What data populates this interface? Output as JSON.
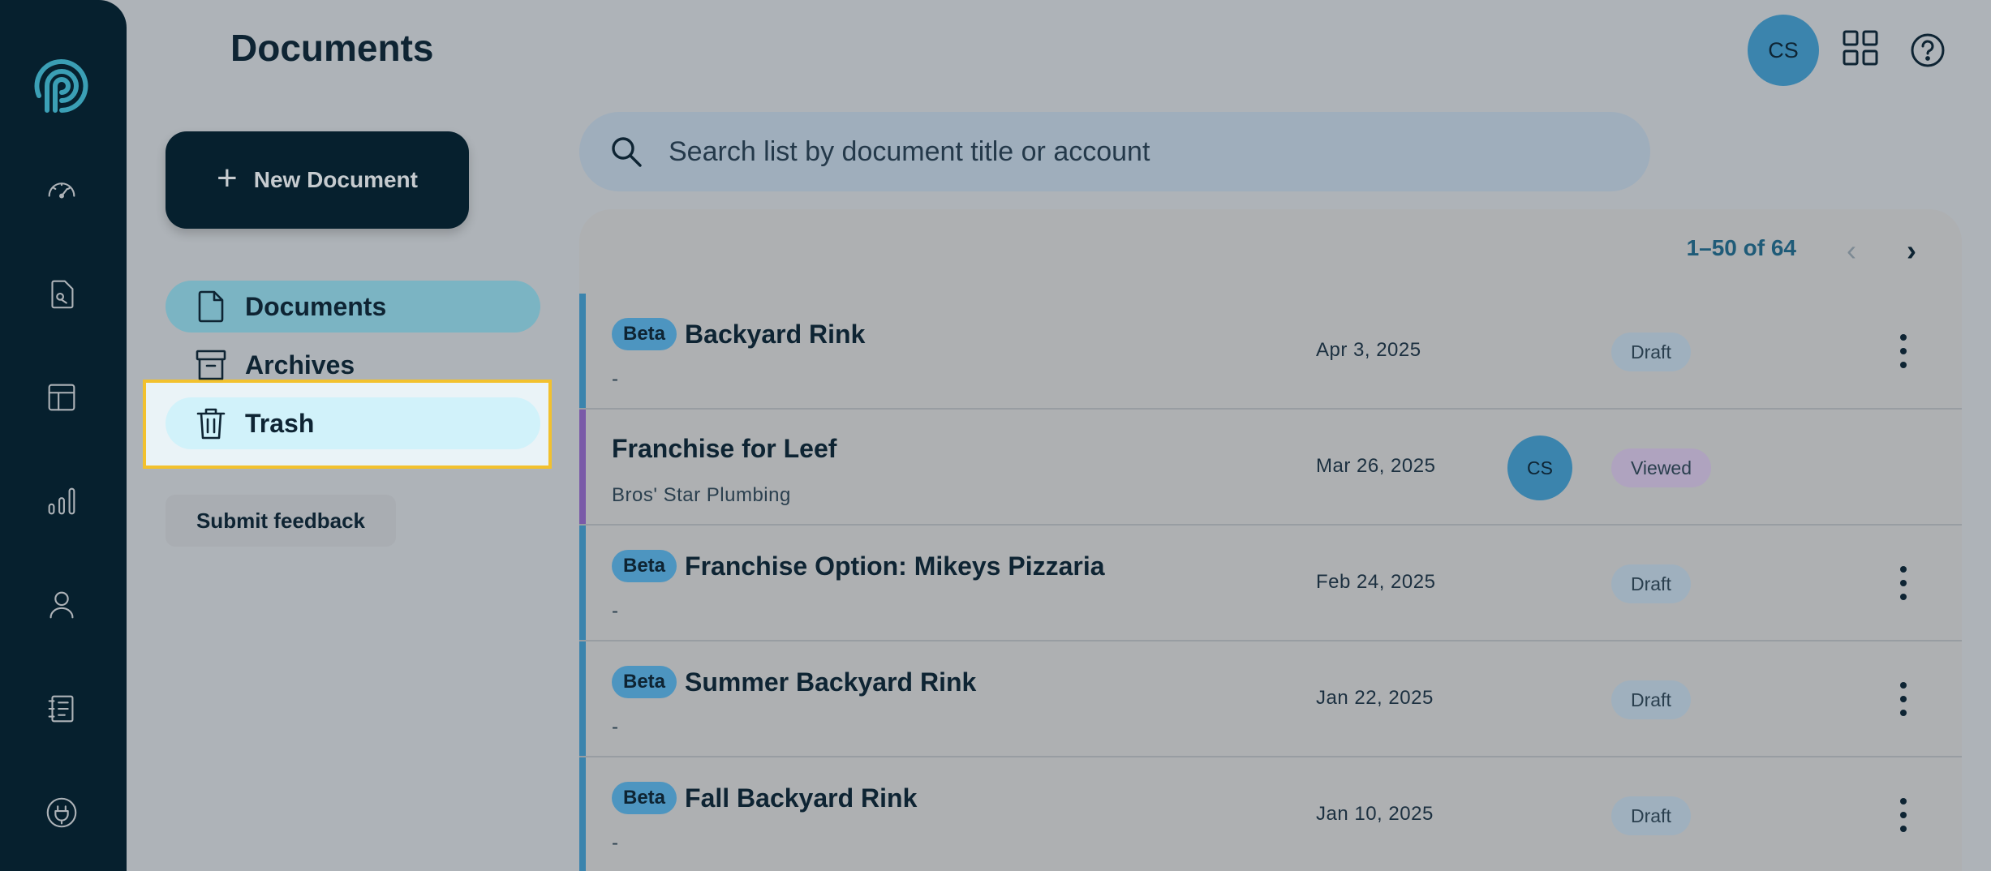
{
  "header": {
    "title": "Documents",
    "user_initials": "CS"
  },
  "rail": {
    "items": [
      "logo-icon",
      "dashboard-icon",
      "documents-icon",
      "templates-icon",
      "analytics-icon",
      "contacts-icon",
      "notebook-icon",
      "integrations-icon"
    ]
  },
  "actions": {
    "new_document": "New Document",
    "submit_feedback": "Submit feedback"
  },
  "nav": {
    "items": [
      {
        "label": "Documents",
        "icon": "document-icon",
        "state": "active"
      },
      {
        "label": "Archives",
        "icon": "archive-icon",
        "state": "normal"
      },
      {
        "label": "Trash",
        "icon": "trash-icon",
        "state": "hover"
      }
    ]
  },
  "search": {
    "placeholder": "Search list by document title or account"
  },
  "pagination": {
    "text": "1–50 of 64"
  },
  "documents": [
    {
      "badge": "Beta",
      "title": "Backyard Rink",
      "subtitle": "-",
      "date": "Apr 3, 2025",
      "assignee": "",
      "status": "Draft"
    },
    {
      "badge": "",
      "title": "Franchise for Leef",
      "subtitle": "Bros' Star Plumbing",
      "date": "Mar 26, 2025",
      "assignee": "CS",
      "status": "Viewed"
    },
    {
      "badge": "Beta",
      "title": "Franchise Option: Mikeys Pizzaria",
      "subtitle": "-",
      "date": "Feb 24, 2025",
      "assignee": "",
      "status": "Draft"
    },
    {
      "badge": "Beta",
      "title": "Summer Backyard Rink",
      "subtitle": "-",
      "date": "Jan 22, 2025",
      "assignee": "",
      "status": "Draft"
    },
    {
      "badge": "Beta",
      "title": "Fall Backyard Rink",
      "subtitle": "-",
      "date": "Jan 10, 2025",
      "assignee": "",
      "status": "Draft"
    }
  ],
  "colors": {
    "rail": "#06202e",
    "accent": "#3b84ad",
    "active_nav": "#7bb4c3",
    "highlight": "#f2c12e",
    "viewed_bar": "#7a5aa8"
  }
}
